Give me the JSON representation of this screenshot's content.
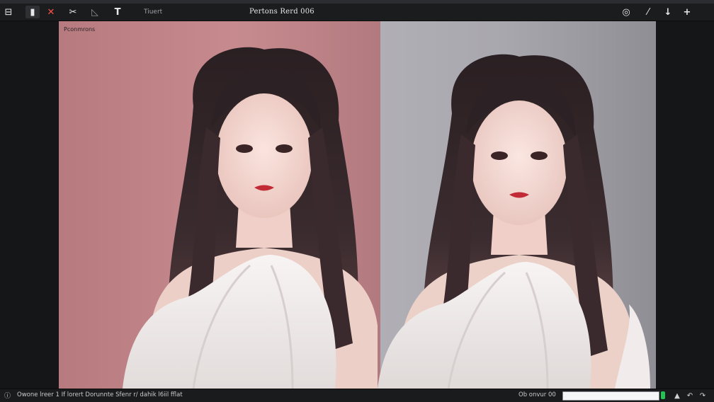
{
  "app": {
    "title": "Pertons Rerd 006"
  },
  "toolbar": {
    "left_buttons": [
      {
        "id": "layout",
        "icon": "layout-icon",
        "glyph": "⊟"
      },
      {
        "id": "panel",
        "icon": "panel-icon",
        "glyph": "▮"
      },
      {
        "id": "close",
        "icon": "close-icon",
        "glyph": "✕"
      },
      {
        "id": "cut",
        "icon": "scissors-icon",
        "glyph": "✂"
      },
      {
        "id": "ruler",
        "icon": "ruler-icon",
        "glyph": "◺"
      },
      {
        "id": "text-tool",
        "icon": "text-tool-icon",
        "glyph": "T"
      }
    ],
    "menu_text": "Tiuert",
    "right_buttons": [
      {
        "id": "target",
        "icon": "target-icon",
        "glyph": "◎"
      },
      {
        "id": "magic",
        "icon": "wand-icon",
        "glyph": "⁄"
      },
      {
        "id": "down",
        "icon": "arrow-down-icon",
        "glyph": "↓"
      },
      {
        "id": "plus",
        "icon": "plus-icon",
        "glyph": "+"
      }
    ]
  },
  "canvas": {
    "label": "Pconmrons",
    "colors": {
      "left_bg": "#c38a8e",
      "right_bg": "#a9a8ae"
    }
  },
  "status": {
    "icon": "info-icon",
    "text": "Owone lreer 1 If lorert Dorunnte Sfenr r/ dahik l6iil fflat",
    "zoom_label": "Ob onvur 00",
    "zoom_value": "",
    "end_icons": [
      {
        "id": "up",
        "icon": "arrow-up-icon",
        "glyph": "▲"
      },
      {
        "id": "undo",
        "icon": "undo-icon",
        "glyph": "↶"
      },
      {
        "id": "redo",
        "icon": "redo-icon",
        "glyph": "↷"
      }
    ],
    "status_color": "#21c453"
  }
}
